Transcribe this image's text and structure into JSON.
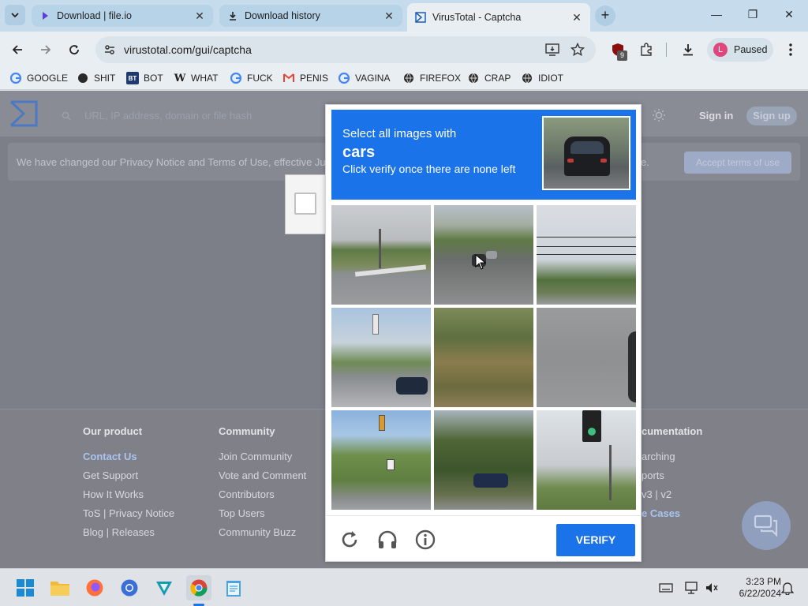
{
  "browser": {
    "tabs": [
      {
        "title": "Download | file.io",
        "icon": "file-io-icon",
        "active": false
      },
      {
        "title": "Download history",
        "icon": "download-icon",
        "active": false
      },
      {
        "title": "VirusTotal - Captcha",
        "icon": "virustotal-icon",
        "active": true
      }
    ],
    "url": "virustotal.com/gui/captcha",
    "extension_badge": "9",
    "profile": {
      "initial": "L",
      "status": "Paused"
    },
    "bookmarks": [
      {
        "label": "GOOGLE",
        "icon": "google-icon"
      },
      {
        "label": "SHIT",
        "icon": "globe-icon"
      },
      {
        "label": "BOT",
        "icon": "bt-icon"
      },
      {
        "label": "WHAT",
        "icon": "w-icon"
      },
      {
        "label": "FUCK",
        "icon": "google-icon"
      },
      {
        "label": "PENIS",
        "icon": "gmail-icon"
      },
      {
        "label": "VAGINA",
        "icon": "google-icon"
      },
      {
        "label": "FIREFOX",
        "icon": "globe-icon"
      },
      {
        "label": "CRAP",
        "icon": "globe-icon"
      },
      {
        "label": "IDIOT",
        "icon": "globe-icon"
      }
    ]
  },
  "virustotal": {
    "search_placeholder": "URL, IP address, domain or file hash",
    "sign_in": "Sign in",
    "sign_up": "Sign up",
    "privacy_notice": "We have changed our Privacy Notice and Terms of Use, effective Jul",
    "privacy_notice_end": "e.",
    "accept_button": "Accept terms of use",
    "footer": {
      "columns": [
        {
          "heading": "Our product",
          "links": [
            "Contact Us",
            "Get Support",
            "How It Works",
            "ToS | Privacy Notice",
            "Blog | Releases"
          ]
        },
        {
          "heading": "Community",
          "links": [
            "Join Community",
            "Vote and Comment",
            "Contributors",
            "Top Users",
            "Community Buzz"
          ]
        },
        {
          "heading": "cumentation",
          "links": [
            "arching",
            "ports",
            "v3 | v2",
            "e Cases"
          ]
        }
      ]
    }
  },
  "captcha": {
    "instruction_line1": "Select all images with",
    "target": "cars",
    "instruction_line3": "Click verify once there are none left",
    "verify_label": "VERIFY",
    "footer_icons": [
      "reload-icon",
      "headphones-icon",
      "info-icon"
    ]
  },
  "taskbar": {
    "apps": [
      "windows-start-icon",
      "file-explorer-icon",
      "firefox-icon",
      "chrome-alt-icon",
      "vpn-icon",
      "chrome-icon",
      "notepad-icon"
    ],
    "time": "3:23 PM",
    "date": "6/22/2024"
  }
}
